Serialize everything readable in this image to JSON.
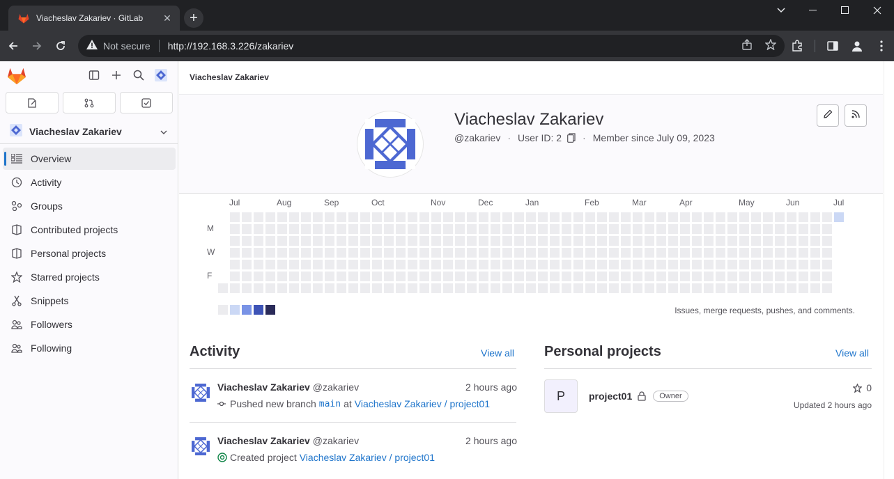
{
  "browser": {
    "tab_title": "Viacheslav Zakariev · GitLab",
    "security": "Not secure",
    "url": "http://192.168.3.226/zakariev"
  },
  "sidebar": {
    "context_name": "Viacheslav Zakariev",
    "items": [
      {
        "label": "Overview",
        "icon": "overview-icon",
        "active": true
      },
      {
        "label": "Activity",
        "icon": "history-icon"
      },
      {
        "label": "Groups",
        "icon": "groups-icon"
      },
      {
        "label": "Contributed projects",
        "icon": "project-icon"
      },
      {
        "label": "Personal projects",
        "icon": "project-icon"
      },
      {
        "label": "Starred projects",
        "icon": "star-icon"
      },
      {
        "label": "Snippets",
        "icon": "snippet-icon"
      },
      {
        "label": "Followers",
        "icon": "users-icon"
      },
      {
        "label": "Following",
        "icon": "users-icon"
      }
    ]
  },
  "breadcrumb": "Viacheslav Zakariev",
  "profile": {
    "name": "Viacheslav Zakariev",
    "username": "@zakariev",
    "user_id": "User ID: 2",
    "member_since": "Member since July 09, 2023"
  },
  "calendar": {
    "months": [
      "Jul",
      "Aug",
      "Sep",
      "Oct",
      "Nov",
      "Dec",
      "Jan",
      "Feb",
      "Mar",
      "Apr",
      "May",
      "Jun",
      "Jul"
    ],
    "days": [
      "M",
      "W",
      "F"
    ],
    "legend_colors": [
      "#ececef",
      "#cbd8f5",
      "#7993e6",
      "#3d53b6",
      "#2a2b59"
    ],
    "note": "Issues, merge requests, pushes, and comments."
  },
  "activity": {
    "title": "Activity",
    "view_all": "View all",
    "events": [
      {
        "name": "Viacheslav Zakariev",
        "user": "@zakariev",
        "time": "2 hours ago",
        "action": "Pushed new branch",
        "branch": "main",
        "at": "at",
        "target": "Viacheslav Zakariev / project01"
      },
      {
        "name": "Viacheslav Zakariev",
        "user": "@zakariev",
        "time": "2 hours ago",
        "action": "Created project",
        "target": "Viacheslav Zakariev / project01"
      }
    ]
  },
  "projects": {
    "title": "Personal projects",
    "view_all": "View all",
    "items": [
      {
        "initial": "P",
        "name": "project01",
        "role": "Owner",
        "stars": "0",
        "updated": "Updated 2 hours ago"
      }
    ]
  }
}
